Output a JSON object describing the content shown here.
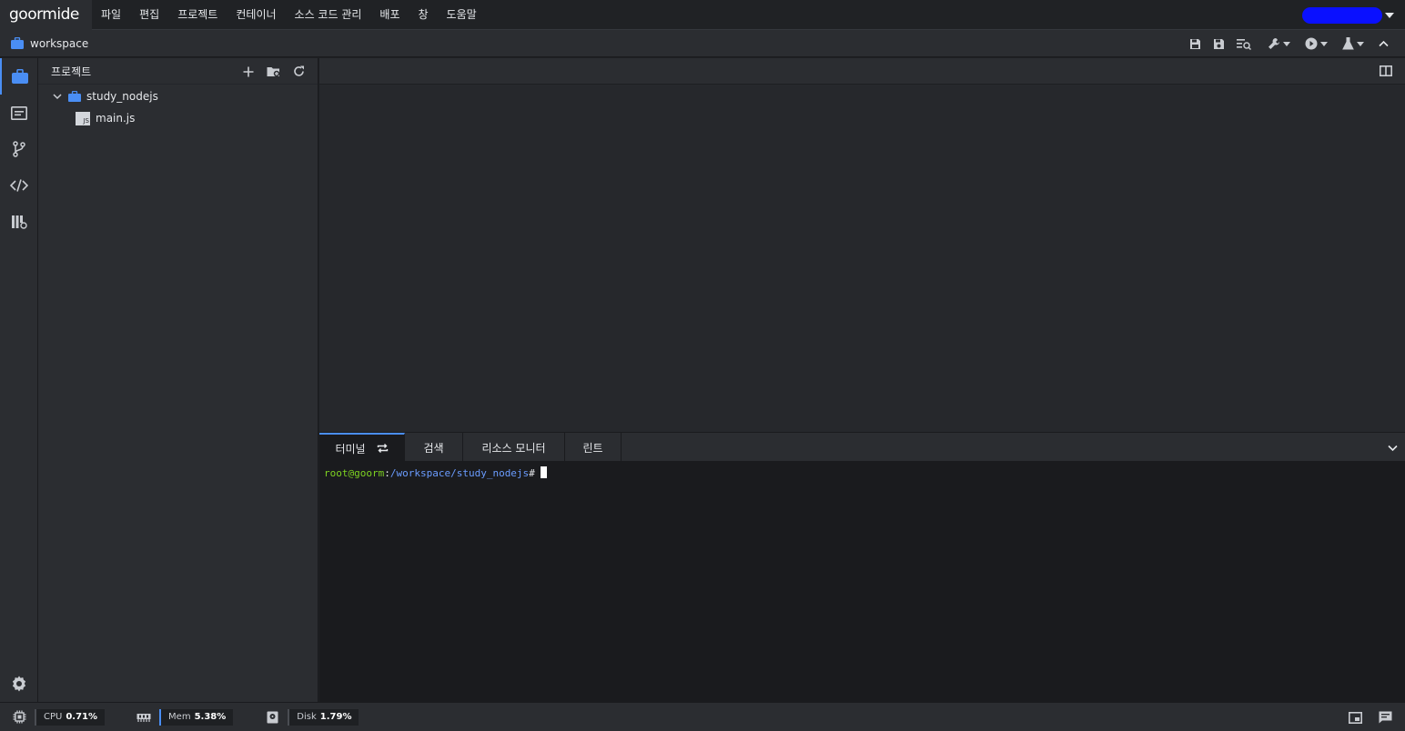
{
  "app": {
    "logo_text": "goormide"
  },
  "menu": [
    "파일",
    "편집",
    "프로젝트",
    "컨테이너",
    "소스 코드 관리",
    "배포",
    "창",
    "도움말"
  ],
  "breadcrumb": {
    "label": "workspace"
  },
  "project_panel": {
    "title": "프로젝트",
    "tree": [
      {
        "label": "study_nodejs",
        "type": "folder",
        "expanded": true
      },
      {
        "label": "main.js",
        "type": "file",
        "badge": "JS"
      }
    ]
  },
  "panel": {
    "tabs": [
      {
        "label": "터미널",
        "active": true
      },
      {
        "label": "검색",
        "active": false
      },
      {
        "label": "리소스 모니터",
        "active": false
      },
      {
        "label": "린트",
        "active": false
      }
    ]
  },
  "terminal": {
    "user": "root@goorm",
    "colon": ":",
    "path": "/workspace/study_nodejs",
    "prompt": "#"
  },
  "status": {
    "cpu_label": "CPU",
    "cpu_value": "0.71%",
    "mem_label": "Mem",
    "mem_value": "5.38%",
    "disk_label": "Disk",
    "disk_value": "1.79%"
  },
  "colors": {
    "accent": "#4a8ef4",
    "terminal_user": "#7ed321",
    "terminal_path": "#6a9cff"
  }
}
